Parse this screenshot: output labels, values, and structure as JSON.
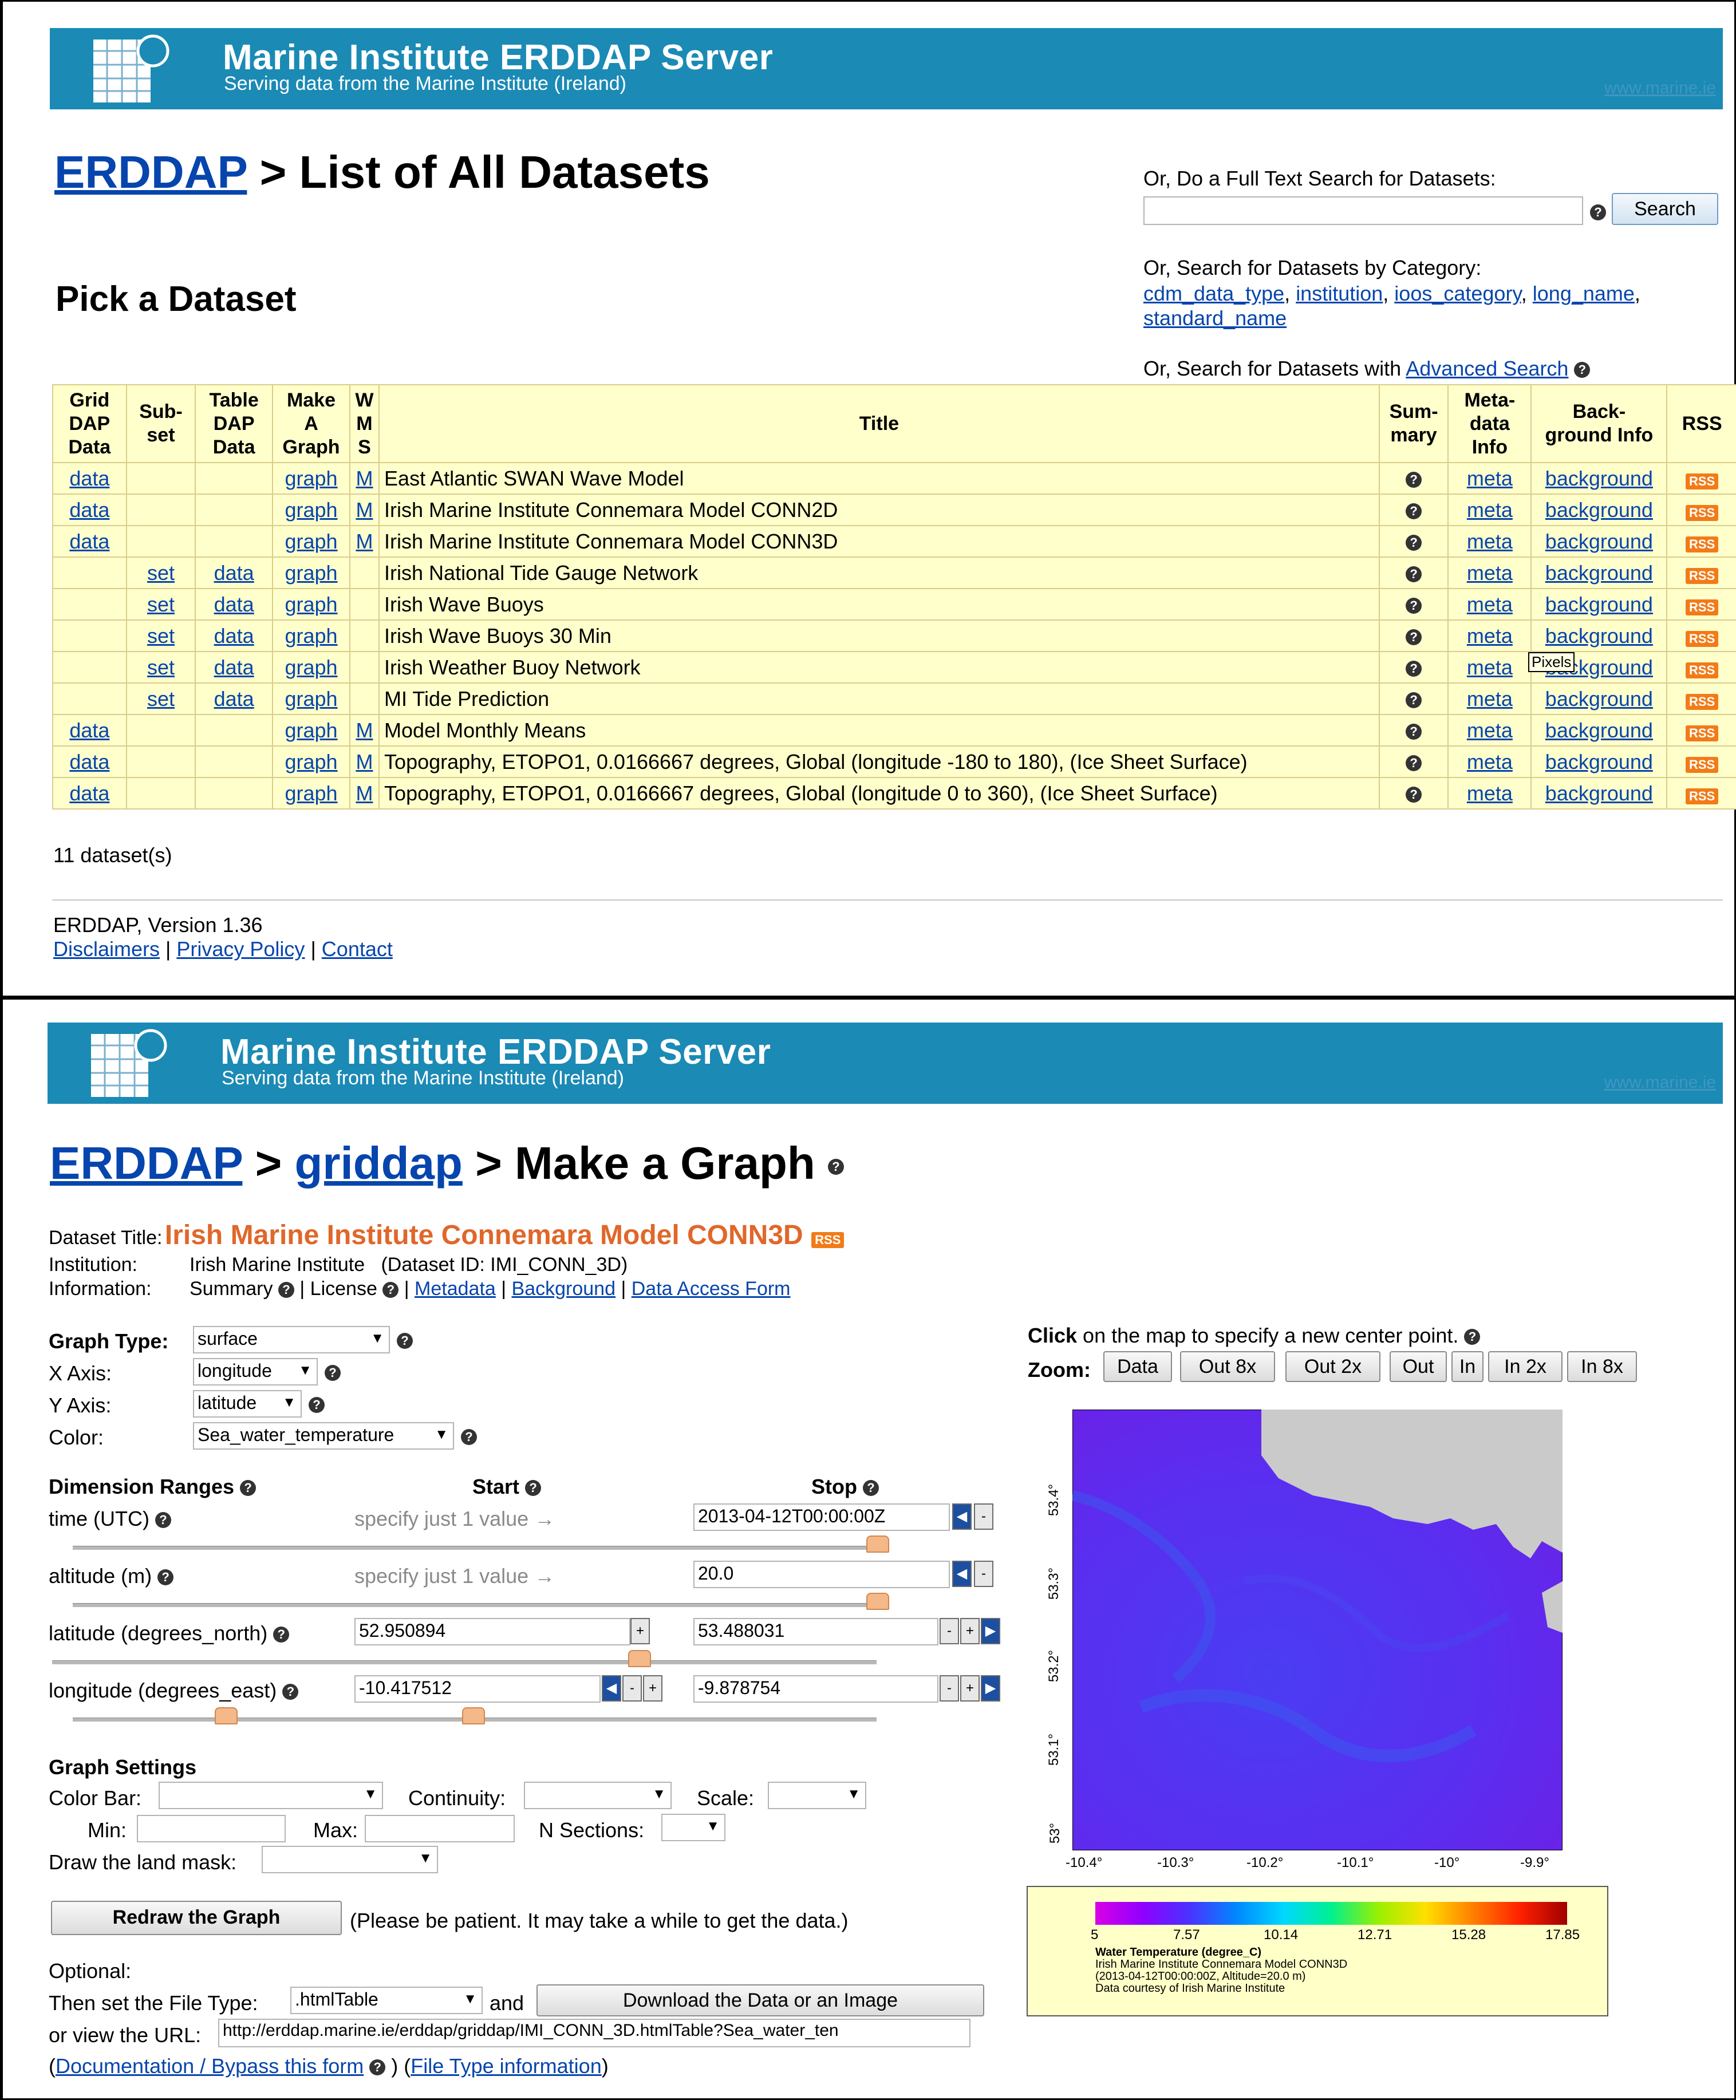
{
  "colors": {
    "banner": "#1b8ab5",
    "table_bg": "#ffffcc",
    "title_orange": "#e0672a",
    "link": "#0645ad"
  },
  "top": {
    "banner": {
      "title": "Marine Institute ERDDAP Server",
      "subtitle": "Serving data from the Marine Institute (Ireland)",
      "link": "www.marine.ie"
    },
    "heading": {
      "link": "ERDDAP",
      "sep": " > ",
      "rest": "List of All Datasets"
    },
    "subheading": "Pick a Dataset",
    "search": {
      "label": "Or, Do a Full Text Search for Datasets:",
      "value": "",
      "button": "Search"
    },
    "category": {
      "label": "Or, Search for Datasets by Category:",
      "links": [
        "cdm_data_type",
        "institution",
        "ioos_category",
        "long_name",
        "standard_name"
      ]
    },
    "advanced": {
      "prefix": "Or, Search for Datasets with ",
      "link": "Advanced Search"
    },
    "table": {
      "headers": {
        "griddap": "Grid DAP Data",
        "subset": "Sub- set",
        "tabledap": "Table DAP Data",
        "graph": "Make A Graph",
        "wms": "W M S",
        "title": "Title",
        "summary": "Sum- mary",
        "meta": "Meta- data Info",
        "background": "Back- ground Info",
        "rss": "RSS"
      },
      "rows": [
        {
          "griddap": "data",
          "subset": "",
          "tabledap": "",
          "graph": "graph",
          "wms": "M",
          "title": "East Atlantic SWAN Wave Model",
          "meta": "meta",
          "background": "background",
          "rss": "RSS"
        },
        {
          "griddap": "data",
          "subset": "",
          "tabledap": "",
          "graph": "graph",
          "wms": "M",
          "title": "Irish Marine Institute Connemara Model CONN2D",
          "meta": "meta",
          "background": "background",
          "rss": "RSS"
        },
        {
          "griddap": "data",
          "subset": "",
          "tabledap": "",
          "graph": "graph",
          "wms": "M",
          "title": "Irish Marine Institute Connemara Model CONN3D",
          "meta": "meta",
          "background": "background",
          "rss": "RSS"
        },
        {
          "griddap": "",
          "subset": "set",
          "tabledap": "data",
          "graph": "graph",
          "wms": "",
          "title": "Irish National Tide Gauge Network",
          "meta": "meta",
          "background": "background",
          "rss": "RSS"
        },
        {
          "griddap": "",
          "subset": "set",
          "tabledap": "data",
          "graph": "graph",
          "wms": "",
          "title": "Irish Wave Buoys",
          "meta": "meta",
          "background": "background",
          "rss": "RSS"
        },
        {
          "griddap": "",
          "subset": "set",
          "tabledap": "data",
          "graph": "graph",
          "wms": "",
          "title": "Irish Wave Buoys 30 Min",
          "meta": "meta",
          "background": "background",
          "rss": "RSS"
        },
        {
          "griddap": "",
          "subset": "set",
          "tabledap": "data",
          "graph": "graph",
          "wms": "",
          "title": "Irish Weather Buoy Network",
          "meta": "meta",
          "background": "background",
          "rss": "RSS"
        },
        {
          "griddap": "",
          "subset": "set",
          "tabledap": "data",
          "graph": "graph",
          "wms": "",
          "title": "MI Tide Prediction",
          "meta": "meta",
          "background": "background",
          "rss": "RSS"
        },
        {
          "griddap": "data",
          "subset": "",
          "tabledap": "",
          "graph": "graph",
          "wms": "M",
          "title": "Model Monthly Means",
          "meta": "meta",
          "background": "background",
          "rss": "RSS"
        },
        {
          "griddap": "data",
          "subset": "",
          "tabledap": "",
          "graph": "graph",
          "wms": "M",
          "title": "Topography, ETOPO1, 0.0166667 degrees, Global (longitude -180 to 180), (Ice Sheet Surface)",
          "meta": "meta",
          "background": "background",
          "rss": "RSS"
        },
        {
          "griddap": "data",
          "subset": "",
          "tabledap": "",
          "graph": "graph",
          "wms": "M",
          "title": "Topography, ETOPO1, 0.0166667 degrees, Global (longitude 0 to 360), (Ice Sheet Surface)",
          "meta": "meta",
          "background": "background",
          "rss": "RSS"
        }
      ]
    },
    "tooltip": "Pixels",
    "count": "11 dataset(s)",
    "version": "ERDDAP, Version 1.36",
    "footer_links": [
      "Disclaimers",
      "Privacy Policy",
      "Contact"
    ],
    "footer_sep": " | "
  },
  "bottom": {
    "banner": {
      "title": "Marine Institute ERDDAP Server",
      "subtitle": "Serving data from the Marine Institute (Ireland)",
      "link": "www.marine.ie"
    },
    "heading": {
      "link1": "ERDDAP",
      "sep": " > ",
      "link2": "griddap",
      "rest": "Make a Graph"
    },
    "dataset": {
      "title_label": "Dataset Title:",
      "title": "Irish Marine Institute Connemara Model CONN3D",
      "rss": "RSS",
      "institution_label": "Institution:",
      "institution": "Irish Marine Institute",
      "dataset_id": "(Dataset ID: IMI_CONN_3D)",
      "information_label": "Information:",
      "summary": "Summary",
      "license": "License",
      "links": [
        "Metadata",
        "Background",
        "Data Access Form"
      ]
    },
    "graph": {
      "type_label": "Graph Type:",
      "type": "surface",
      "x_label": "X Axis:",
      "x": "longitude",
      "y_label": "Y Axis:",
      "y": "latitude",
      "color_label": "Color:",
      "color": "Sea_water_temperature"
    },
    "dims": {
      "header": "Dimension Ranges",
      "start": "Start",
      "stop": "Stop",
      "rows": [
        {
          "label": "time (UTC)",
          "start": "specify just 1 value →",
          "stop": "2013-04-12T00:00:00Z"
        },
        {
          "label": "altitude (m)",
          "start": "specify just 1 value →",
          "stop": "20.0"
        },
        {
          "label": "latitude (degrees_north)",
          "start": "52.950894",
          "stop": "53.488031"
        },
        {
          "label": "longitude (degrees_east)",
          "start": "-10.417512",
          "stop": "-9.878754"
        }
      ]
    },
    "settings": {
      "header": "Graph Settings",
      "colorbar": "Color Bar:",
      "continuity": "Continuity:",
      "scale": "Scale:",
      "min": "Min:",
      "max": "Max:",
      "nsections": "N Sections:",
      "landmask": "Draw the land mask:"
    },
    "redraw": {
      "button": "Redraw the Graph",
      "note": "(Please be patient. It may take a while to get the data.)"
    },
    "optional": {
      "label": "Optional:",
      "filetype_label": "Then set the File Type:",
      "filetype": ".htmlTable",
      "and": "and",
      "download": "Download the Data or an Image",
      "url_label": "or view the URL:",
      "url": "http://erddap.marine.ie/erddap/griddap/IMI_CONN_3D.htmlTable?Sea_water_ten",
      "doc": "Documentation / Bypass this form",
      "filetype_info": "File Type information"
    },
    "map": {
      "click_bold": "Click",
      "click_rest": " on the map to specify a new center point.",
      "zoom_label": "Zoom:",
      "zoom_buttons": [
        "Data",
        "Out 8x",
        "Out 2x",
        "Out",
        "In",
        "In 2x",
        "In 8x"
      ],
      "lat_ticks": [
        "53.4°",
        "53.3°",
        "53.2°",
        "53.1°",
        "53°"
      ],
      "lon_ticks": [
        "-10.4°",
        "-10.3°",
        "-10.2°",
        "-10.1°",
        "-10°",
        "-9.9°"
      ],
      "colorbar_ticks": [
        "5",
        "7.57",
        "10.14",
        "12.71",
        "15.28",
        "17.85"
      ],
      "legend": [
        "Water Temperature (degree_C)",
        "Irish Marine Institute Connemara Model CONN3D",
        "(2013-04-12T00:00:00Z, Altitude=20.0 m)",
        "Data courtesy of Irish Marine Institute"
      ]
    }
  }
}
